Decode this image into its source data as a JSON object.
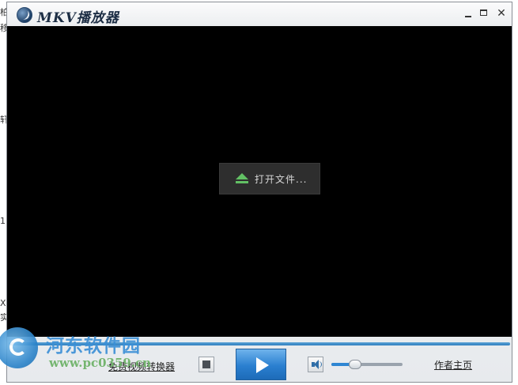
{
  "background_fragments": [
    "柏",
    "移",
    "轩",
    "1",
    "X",
    "实"
  ],
  "window": {
    "title": "MKV播放器",
    "buttons": {
      "minimize_icon": "minimize-icon",
      "maximize_icon": "maximize-icon",
      "close_icon": "close-icon"
    }
  },
  "video": {
    "open_file_label": "打开文件..."
  },
  "controls": {
    "converter_link": "免费视频转换器",
    "author_link": "作者主页",
    "volume_level": 0.33,
    "accent_color": "#2f86d3",
    "play_icon": "play-icon",
    "stop_icon": "stop-icon",
    "volume_icon": "speaker-icon"
  },
  "watermark": {
    "title": "河东软件园",
    "url": "www.pc0359.cn"
  }
}
